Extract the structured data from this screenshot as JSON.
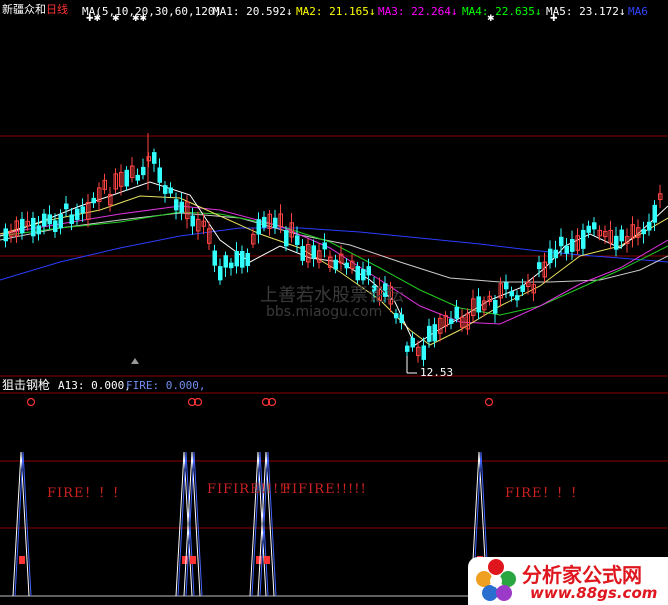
{
  "header": {
    "stock_name": "新疆众和",
    "period": "日线",
    "ma_params": "MA(5,10,20,30,60,120)",
    "ma1": "MA1: 20.592↓",
    "ma2": "MA2: 21.165↓",
    "ma3": "MA3: 22.264↓",
    "ma4": "MA4: 22.635↓",
    "ma5": "MA5: 23.172↓",
    "ma6": "MA6"
  },
  "price_panel": {
    "low_label": "12.53",
    "watermark_cn": "上善若水股票论坛",
    "watermark_url": "bbs.miaogu.com"
  },
  "indicator": {
    "name": "狙击钢枪",
    "a13": "A13: 0.000,",
    "fire": "FIRE: 0.000,",
    "fire_text_1": "FIRE！！！",
    "fire_text_2": "FIFIRE!!!!!",
    "fire_text_3": "FIFIRE!!!!!",
    "fire_text_4": "FIRE！！！"
  },
  "logo": {
    "cn": "分析家公式网",
    "url": "www.88gs.com"
  },
  "colors": {
    "ma1": "#ffffff",
    "ma2": "#ffff00",
    "ma3": "#ff00ff",
    "ma4": "#00ff00",
    "ma5": "#ffffff",
    "ma6": "#3333ff",
    "up": "#ff3333",
    "down": "#00ffff",
    "grid": "#880000"
  }
}
